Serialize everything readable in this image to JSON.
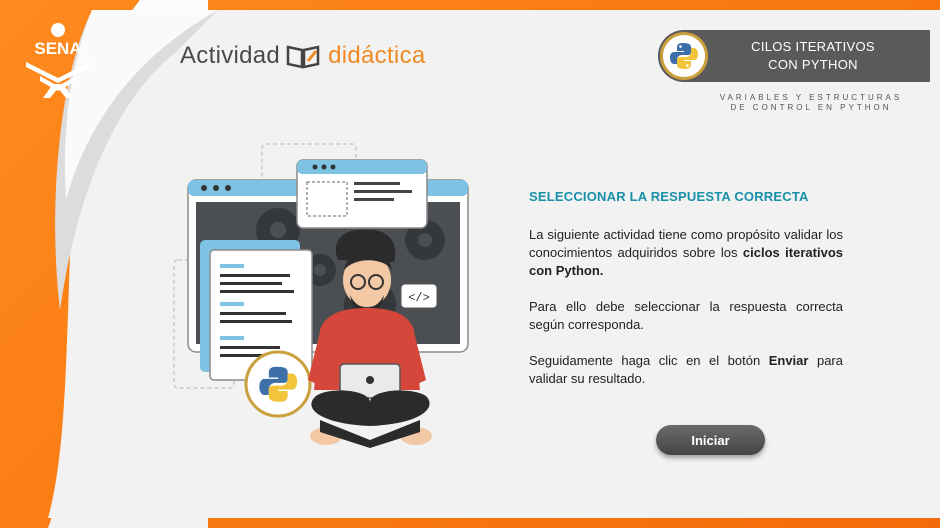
{
  "logo": {
    "text": "SENA"
  },
  "brand": {
    "word1": "Actividad",
    "word2": "didáctica"
  },
  "badge": {
    "line1": "CILOS ITERATIVOS",
    "line2": "CON PYTHON",
    "icon": "python-logo"
  },
  "subtitle": {
    "line1": "VARIABLES Y ESTRUCTURAS",
    "line2": "DE CONTROL EN PYTHON"
  },
  "content": {
    "heading": "SELECCIONAR LA RESPUESTA CORRECTA",
    "p1_start": "La siguiente actividad tiene como propósito validar los conocimientos adquiridos sobre los ",
    "p1_bold": "ciclos iterativos con Python.",
    "p2": "Para ello debe seleccionar la respuesta correcta según corresponda.",
    "p3_start": "Seguidamente haga clic en el botón ",
    "p3_bold": "Enviar",
    "p3_end": " para validar su resultado."
  },
  "button": {
    "label": "Iniciar"
  },
  "illustration": {
    "code_tag": "</>"
  },
  "colors": {
    "orange": "#f57a10",
    "teal": "#1891a8",
    "badge_gray": "#5a5a5a",
    "gold": "#c9a03c"
  }
}
